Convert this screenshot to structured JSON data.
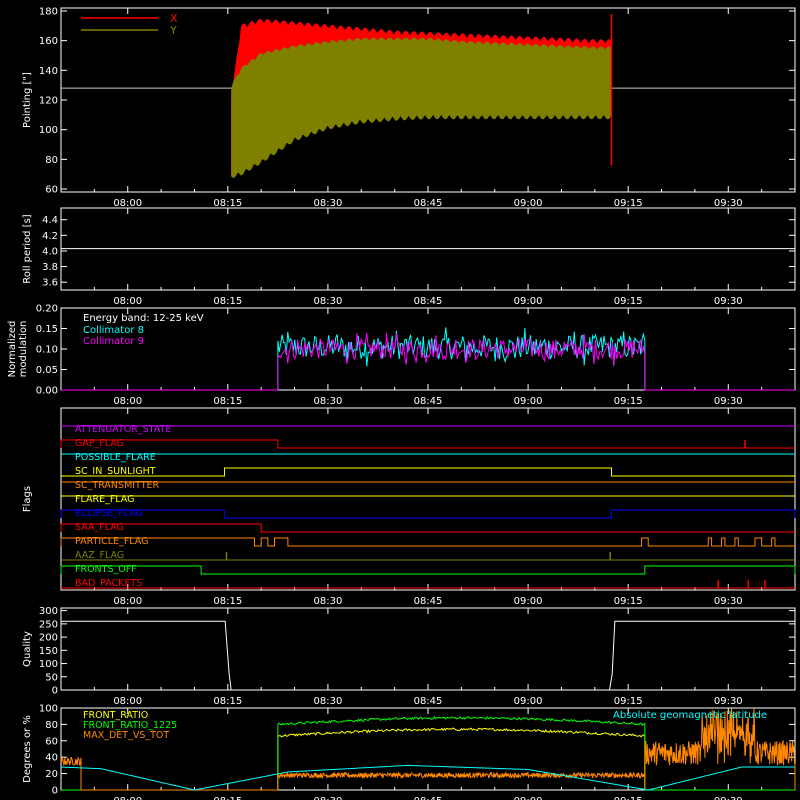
{
  "time_axis": {
    "tick_labels": [
      "08:00",
      "08:15",
      "08:30",
      "08:45",
      "09:00",
      "09:15",
      "09:30"
    ],
    "tick_minutes": [
      480,
      495,
      510,
      525,
      540,
      555,
      570
    ],
    "range_minutes": [
      470,
      580
    ]
  },
  "colors": {
    "background": "#000000",
    "axes": "#ffffff",
    "red": "#ff0000",
    "olive": "#808000",
    "cyan": "#00ffff",
    "magenta": "#ff00ff",
    "green": "#00ff00",
    "yellow": "#ffff00",
    "orange": "#ff8800",
    "blue": "#0000ff",
    "purple": "#cc00ff"
  },
  "chart_data": [
    {
      "id": "pointing",
      "type": "area",
      "ylabel": "Pointing [\"]",
      "ylim": [
        58,
        182
      ],
      "yticks": [
        60,
        80,
        100,
        120,
        140,
        160,
        180
      ],
      "reference_line": 128,
      "legend_placement": "top-left",
      "series": [
        {
          "name": "X",
          "color": "#ff0000",
          "start": 495.5,
          "end": 552.5,
          "x": [
            495.5,
            497,
            500,
            505,
            510,
            515,
            520,
            525,
            530,
            535,
            540,
            545,
            550,
            552.5
          ],
          "upper": [
            120,
            168,
            172,
            170,
            168,
            166,
            164,
            163,
            162,
            161,
            160,
            159,
            158,
            158
          ],
          "lower": [
            70,
            88,
            108,
            120,
            127,
            132,
            136,
            138,
            140,
            141,
            142,
            142,
            142,
            142
          ]
        },
        {
          "name": "Y",
          "color": "#808000",
          "start": 495.5,
          "end": 552.5,
          "x": [
            495.5,
            497,
            500,
            505,
            510,
            515,
            520,
            525,
            530,
            535,
            540,
            545,
            550,
            552.5
          ],
          "upper": [
            128,
            140,
            150,
            155,
            158,
            160,
            160,
            160,
            158,
            157,
            156,
            155,
            154,
            154
          ],
          "lower": [
            70,
            72,
            80,
            95,
            103,
            107,
            109,
            110,
            110,
            110,
            110,
            110,
            110,
            110
          ]
        }
      ]
    },
    {
      "id": "roll_period",
      "type": "line",
      "ylabel": "Roll period [s]",
      "ylim": [
        3.5,
        4.55
      ],
      "yticks": [
        3.6,
        3.8,
        4.0,
        4.2,
        4.4
      ],
      "tick_labels": [
        "3.6",
        "3.8",
        "4.0",
        "4.2",
        "4.4"
      ],
      "series": [
        {
          "name": "",
          "color": "#ffffff",
          "constant": 4.03
        }
      ]
    },
    {
      "id": "modulation",
      "type": "line",
      "ylabel": "Normalized modulation",
      "ylim": [
        0,
        0.2
      ],
      "yticks": [
        0,
        0.05,
        0.1,
        0.15,
        0.2
      ],
      "tick_labels": [
        "0.00",
        "0.05",
        "0.10",
        "0.15",
        "0.20"
      ],
      "annotation": "Energy band: 12-25 keV",
      "series": [
        {
          "name": "Collimator 8",
          "color": "#00ffff",
          "start": 502.5,
          "end": 557.5,
          "mean": 0.105,
          "noise": 0.03
        },
        {
          "name": "Collimator 9",
          "color": "#ff00ff",
          "start": 502.5,
          "end": 557.5,
          "mean": 0.1,
          "noise": 0.025
        }
      ]
    },
    {
      "id": "flags",
      "type": "line",
      "ylabel": "Flags",
      "flags": [
        {
          "name": "ATTENUATOR_STATE",
          "color": "#cc00ff",
          "high": [],
          "always": true
        },
        {
          "name": "GAP_FLAG",
          "color": "#ff0000",
          "high": [
            [
              470,
              502.5
            ]
          ],
          "spikes": [
            572.5
          ]
        },
        {
          "name": "POSSIBLE_FLARE",
          "color": "#00ffff",
          "high": [],
          "always": true
        },
        {
          "name": "SC_IN_SUNLIGHT",
          "color": "#ffff00",
          "high": [
            [
              494.5,
              552.5
            ]
          ]
        },
        {
          "name": "SC_TRANSMITTER",
          "color": "#ff8800",
          "high": [],
          "always": true
        },
        {
          "name": "FLARE_FLAG",
          "color": "#ffff00",
          "high": [],
          "always": true
        },
        {
          "name": "ECLIPSE_FLAG",
          "color": "#0000ff",
          "high": [
            [
              470,
              494.5
            ],
            [
              552.5,
              580
            ]
          ]
        },
        {
          "name": "SAA_FLAG",
          "color": "#ff0000",
          "high": [
            [
              470,
              500
            ]
          ]
        },
        {
          "name": "PARTICLE_FLAG",
          "color": "#ff8800",
          "high": [
            [
              470,
              499
            ],
            [
              500,
              501
            ],
            [
              502,
              504
            ],
            [
              557,
              558
            ],
            [
              567,
              567.5
            ],
            [
              569,
              569.5
            ],
            [
              571,
              571.5
            ],
            [
              574,
              575
            ],
            [
              576.5,
              577
            ]
          ]
        },
        {
          "name": "AAZ_FLAG",
          "color": "#808000",
          "spikes": [
            494.8,
            552.3
          ]
        },
        {
          "name": "FRONTS_OFF",
          "color": "#00ff00",
          "high": [
            [
              470,
              491
            ],
            [
              557.5,
              580
            ]
          ]
        },
        {
          "name": "BAD_PACKETS",
          "color": "#ff0000",
          "spikes": [
            568.5,
            573,
            575.5
          ]
        }
      ]
    },
    {
      "id": "quality",
      "type": "line",
      "ylabel": "Quality",
      "ylim": [
        0,
        310
      ],
      "yticks": [
        0,
        50,
        100,
        150,
        200,
        250,
        300
      ],
      "tick_labels": [
        "0",
        "50",
        "100",
        "150",
        "200",
        "250",
        "300"
      ],
      "series": [
        {
          "name": "",
          "color": "#ffffff",
          "x": [
            470,
            494.6,
            495.2,
            495.5,
            552.2,
            552.6,
            553,
            580
          ],
          "y": [
            260,
            260,
            60,
            0,
            0,
            60,
            260,
            260
          ]
        }
      ]
    },
    {
      "id": "ratios",
      "type": "line",
      "ylabel": "Degrees or %",
      "ylim": [
        0,
        100
      ],
      "yticks": [
        0,
        20,
        40,
        60,
        80,
        100
      ],
      "tick_labels": [
        "0",
        "20",
        "40",
        "60",
        "80",
        "100"
      ],
      "series": [
        {
          "name": "FRONT_RATIO",
          "color": "#ffff00",
          "start": 502.5,
          "end": 557.5,
          "level": 70,
          "arch": 8
        },
        {
          "name": "FRONT_RATIO_1225",
          "color": "#00ff00",
          "start": 502.5,
          "end": 557.5,
          "level": 84,
          "arch": 8
        },
        {
          "name": "MAX_DET_VS_TOT",
          "color": "#ff8800",
          "segments": [
            [
              470,
              473,
              35
            ],
            [
              502.5,
              557.5,
              18
            ],
            [
              557.5,
              580,
              45
            ]
          ]
        },
        {
          "name": "Absolute geomagnetic latitude",
          "color": "#00ffff",
          "x": [
            470,
            476,
            490,
            504,
            522,
            540,
            558,
            572,
            580
          ],
          "y": [
            28,
            26,
            0,
            22,
            30,
            25,
            0,
            28,
            28
          ]
        }
      ]
    }
  ]
}
